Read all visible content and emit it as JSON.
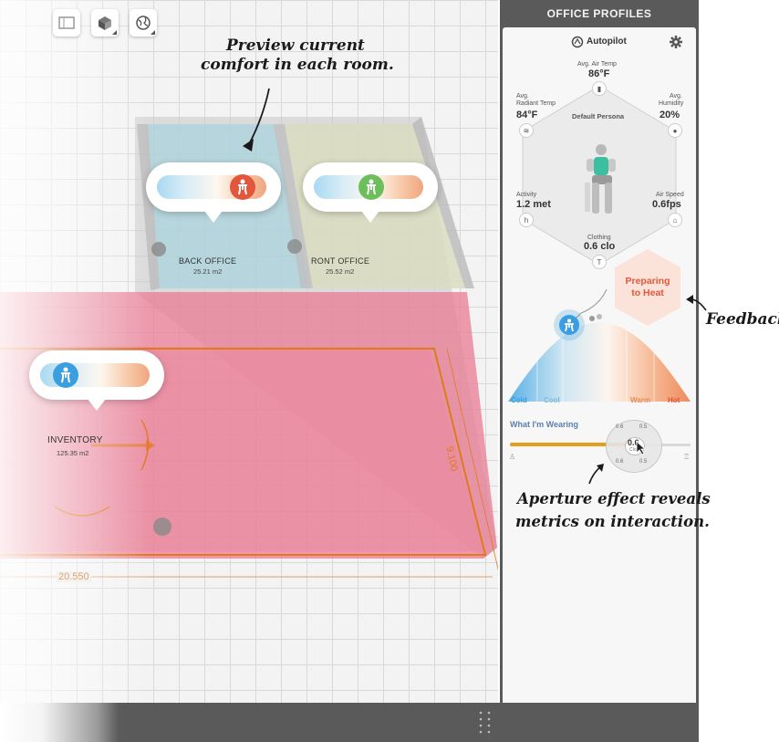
{
  "toolbar": {
    "icons": [
      "panel-icon",
      "cube-view-icon",
      "globe-icon"
    ]
  },
  "rooms": [
    {
      "name": "BACK OFFICE",
      "area": "25.21 m2"
    },
    {
      "name": "RONT OFFICE",
      "area": "25.52 m2"
    },
    {
      "name": "INVENTORY",
      "area": "125.35 m2"
    }
  ],
  "dimensions": {
    "width": "20.550",
    "depth": "9.100"
  },
  "annotations": {
    "preview_line1": "Preview current",
    "preview_line2": "comfort in each room.",
    "feedback": "Feedback",
    "aperture_line1": "Aperture effect reveals",
    "aperture_line2": "metrics on interaction."
  },
  "panel": {
    "title": "OFFICE PROFILES",
    "mode_label": "Autopilot",
    "persona": "Default Persona",
    "metrics": {
      "air_temp": {
        "label": "Avg. Air Temp",
        "value": "86°F"
      },
      "radiant_temp": {
        "label_line1": "Avg.",
        "label_line2": "Radiant Temp",
        "value": "84°F"
      },
      "humidity": {
        "label_line1": "Avg.",
        "label_line2": "Humidity",
        "value": "20%"
      },
      "activity": {
        "label": "Activity",
        "value": "1.2 met"
      },
      "air_speed": {
        "label": "Air Speed",
        "value": "0.6fps"
      },
      "clothing": {
        "label": "Clothing",
        "value": "0.6 clo"
      }
    },
    "status_line1": "Preparing",
    "status_line2": "to Heat",
    "scale_labels": [
      "Cold",
      "Cool",
      "Warm",
      "Hot"
    ],
    "wearing_label": "What I'm Wearing",
    "aperture_ticks": [
      "0.6",
      "0.5",
      "0.6",
      "0.5"
    ],
    "aperture_value": "0.6",
    "aperture_sub": "Clo"
  },
  "colors": {
    "accent_orange": "#e2791a",
    "status_red": "#e2573b",
    "status_green": "#6cbf5a",
    "person_blue": "#3a9ee0",
    "panel_dark": "#5a5a5a"
  }
}
